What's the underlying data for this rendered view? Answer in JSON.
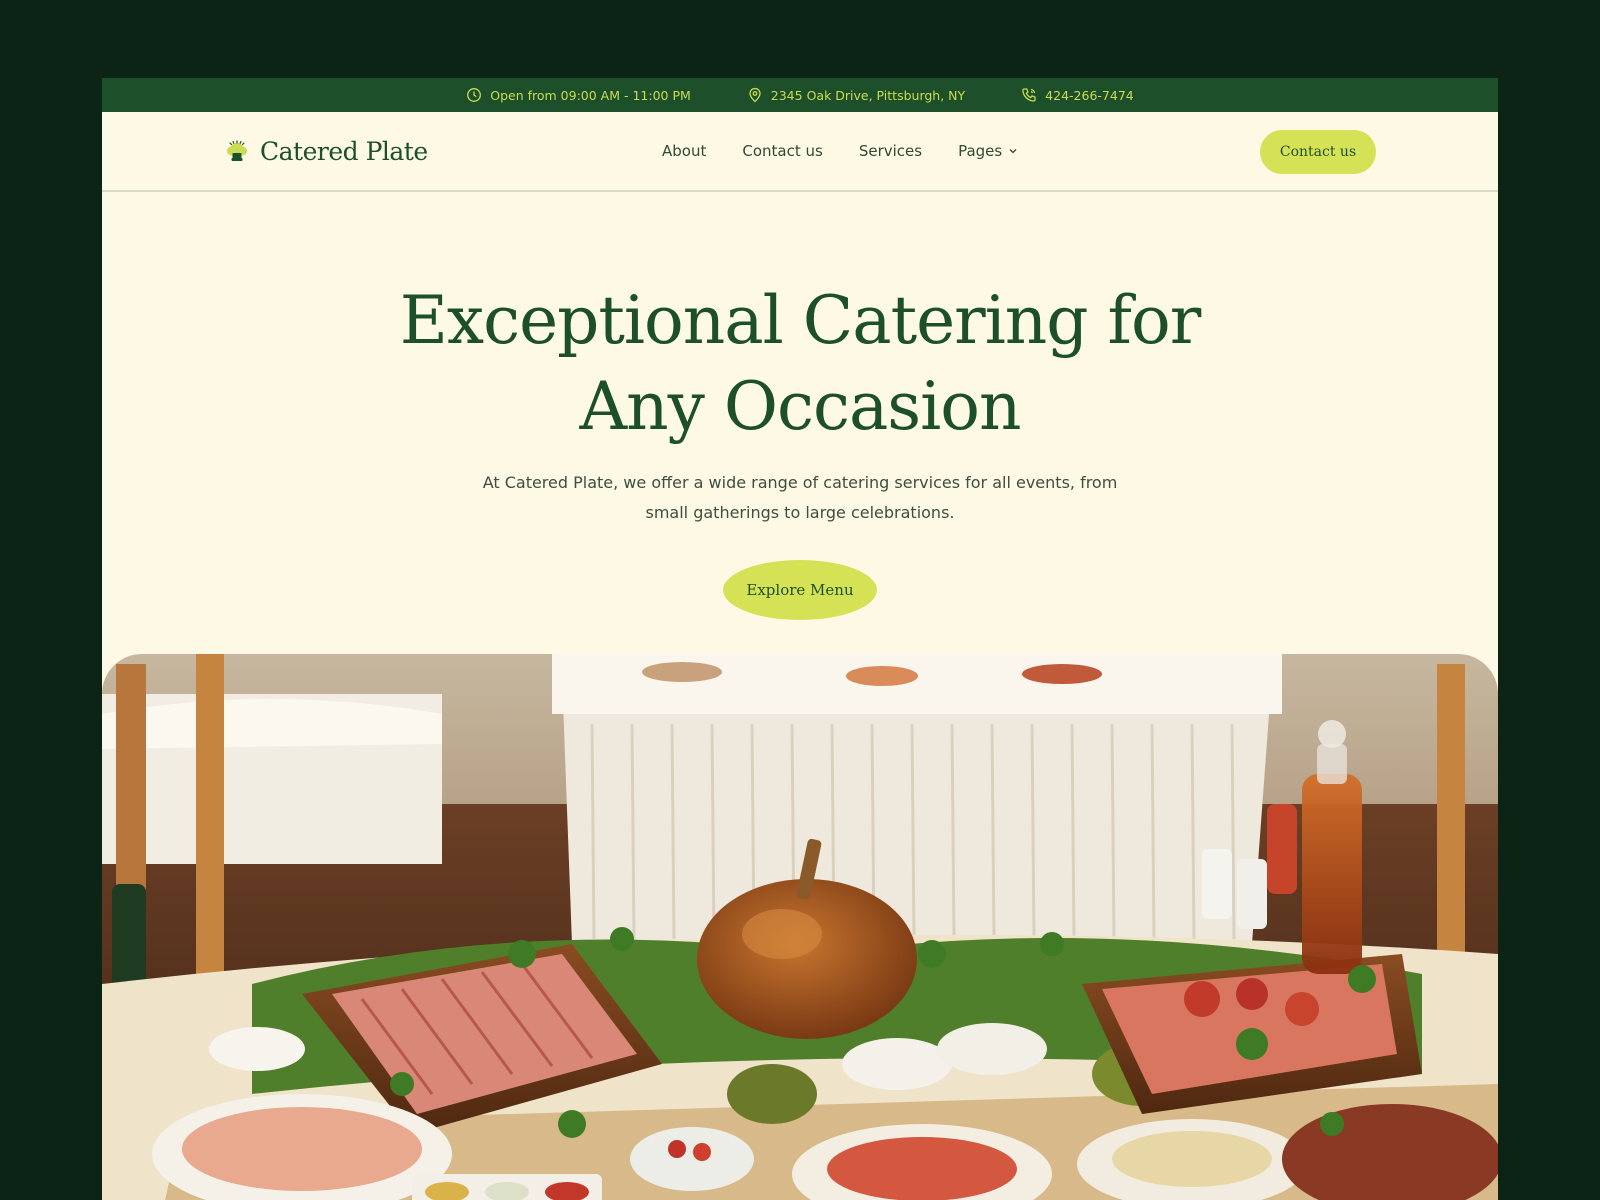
{
  "topbar": {
    "hours": "Open from 09:00 AM - 11:00 PM",
    "address": "2345 Oak Drive, Pittsburgh, NY",
    "phone": "424-266-7474"
  },
  "brand": {
    "name": "Catered Plate"
  },
  "nav": {
    "items": [
      {
        "label": "About"
      },
      {
        "label": "Contact us"
      },
      {
        "label": "Services"
      },
      {
        "label": "Pages"
      }
    ],
    "cta_label": "Contact us"
  },
  "hero": {
    "title_line1": "Exceptional Catering for",
    "title_line2": "Any Occasion",
    "subtitle": "At Catered Plate, we offer a wide range of catering services for all events, from small gatherings to large celebrations.",
    "cta_label": "Explore Menu"
  },
  "colors": {
    "page_bg": "#0c2416",
    "frame_bg": "#fdf9e4",
    "brand_green": "#1d4f2b",
    "accent_lime": "#d6e256",
    "topbar_text": "#c9dc52"
  },
  "icons": {
    "hours": "clock-icon",
    "address": "location-pin-icon",
    "phone": "phone-icon",
    "brand": "chef-hat-icon",
    "pages_dropdown": "chevron-down-icon"
  }
}
